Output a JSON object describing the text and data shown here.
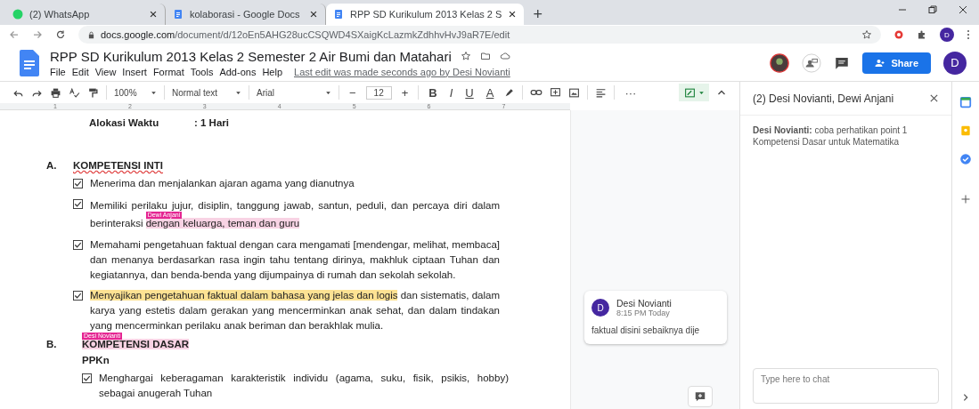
{
  "browser": {
    "tabs": [
      {
        "title": "(2) WhatsApp",
        "selected": false
      },
      {
        "title": "kolaborasi - Google Docs",
        "selected": false
      },
      {
        "title": "RPP SD Kurikulum 2013 Kelas 2 S",
        "selected": true
      }
    ],
    "new_tab": "+",
    "url_host": "docs.google.com",
    "url_path": "/document/d/12oEn5AHG28ucCSQWD4SXaigKcLazmkZdhhvHvJ9aR7E/edit",
    "profile": "D"
  },
  "document_header": {
    "title": "RPP SD Kurikulum 2013 Kelas 2 Semester 2 Air Bumi dan Matahari",
    "menu": [
      "File",
      "Edit",
      "View",
      "Insert",
      "Format",
      "Tools",
      "Add-ons",
      "Help"
    ],
    "last_edit": "Last edit was made seconds ago by Desi Novianti",
    "share": "Share",
    "avatar": "D"
  },
  "toolbar": {
    "zoom": "100%",
    "style": "Normal text",
    "font": "Arial",
    "font_size": "12",
    "minus": "−",
    "plus": "+",
    "format": [
      "B",
      "I",
      "U",
      "A"
    ],
    "more": "···"
  },
  "ruler": {
    "marks": [
      "1",
      "2",
      "3",
      "4",
      "5",
      "6",
      "7"
    ]
  },
  "document": {
    "info": [
      {
        "label": "Alokasi Waktu",
        "value": ": 1 Hari"
      }
    ],
    "sections": [
      {
        "letter": "A.",
        "heading": [
          {
            "text": "KOMPETENSI INTI"
          }
        ],
        "items": [
          {
            "checked": true,
            "segments": [
              {
                "text": "Menerima dan menjalankan ajaran agama yang dianutnya"
              }
            ]
          },
          {
            "checked": true,
            "segments": [
              {
                "text": "Memiliki perilaku jujur, disiplin, tanggung jawab, santun, peduli, dan percaya diri dalam berinteraksi "
              },
              {
                "text": "dengan keluarga, teman dan guru",
                "cursor_name": "Dewi Anjani"
              }
            ]
          },
          {
            "checked": true,
            "segments": [
              {
                "text": "Memahami pengetahuan faktual dengan cara mengamati [mendengar, melihat, membaca] dan menanya berdasarkan rasa ingin tahu tentang dirinya, makhluk ciptaan Tuhan dan kegiatannya, dan benda-benda yang dijumpainya di rumah dan sekolah sekolah."
              }
            ]
          },
          {
            "checked": true,
            "segments": [
              {
                "text": "Menyajikan pengetahuan faktual dalam bahasa yang jelas dan logis",
                "commented": true
              },
              {
                "text": " dan sistematis, dalam karya yang estetis dalam gerakan yang mencerminkan anak sehat, dan dalam tindakan yang mencerminkan perilaku anak beriman dan berakhlak mulia."
              }
            ]
          }
        ]
      },
      {
        "letter": "B.",
        "heading": [
          {
            "text": "KOMPETENSI DASAR",
            "cursor_name": "Desi Novianti"
          }
        ],
        "subheading": "PPKn",
        "items": [
          {
            "checked": true,
            "segments": [
              {
                "text": "Menghargai keberagaman karakteristik individu (agama, suku, fisik, psikis, hobby) sebagai anugerah Tuhan"
              }
            ]
          }
        ]
      }
    ]
  },
  "comments": [
    {
      "author": "Desi Novianti",
      "time": "8:15 PM Today",
      "text": "faktual disini sebaiknya dije",
      "avatar": "D"
    }
  ],
  "chat": {
    "title": "(2) Desi Novianti, Dewi Anjani",
    "messages": [
      {
        "text": "**Desi Novianti:** coba perhatikan point 1 Kompetensi Dasar untuk Matematika"
      }
    ],
    "placeholder": "Type here to chat"
  }
}
